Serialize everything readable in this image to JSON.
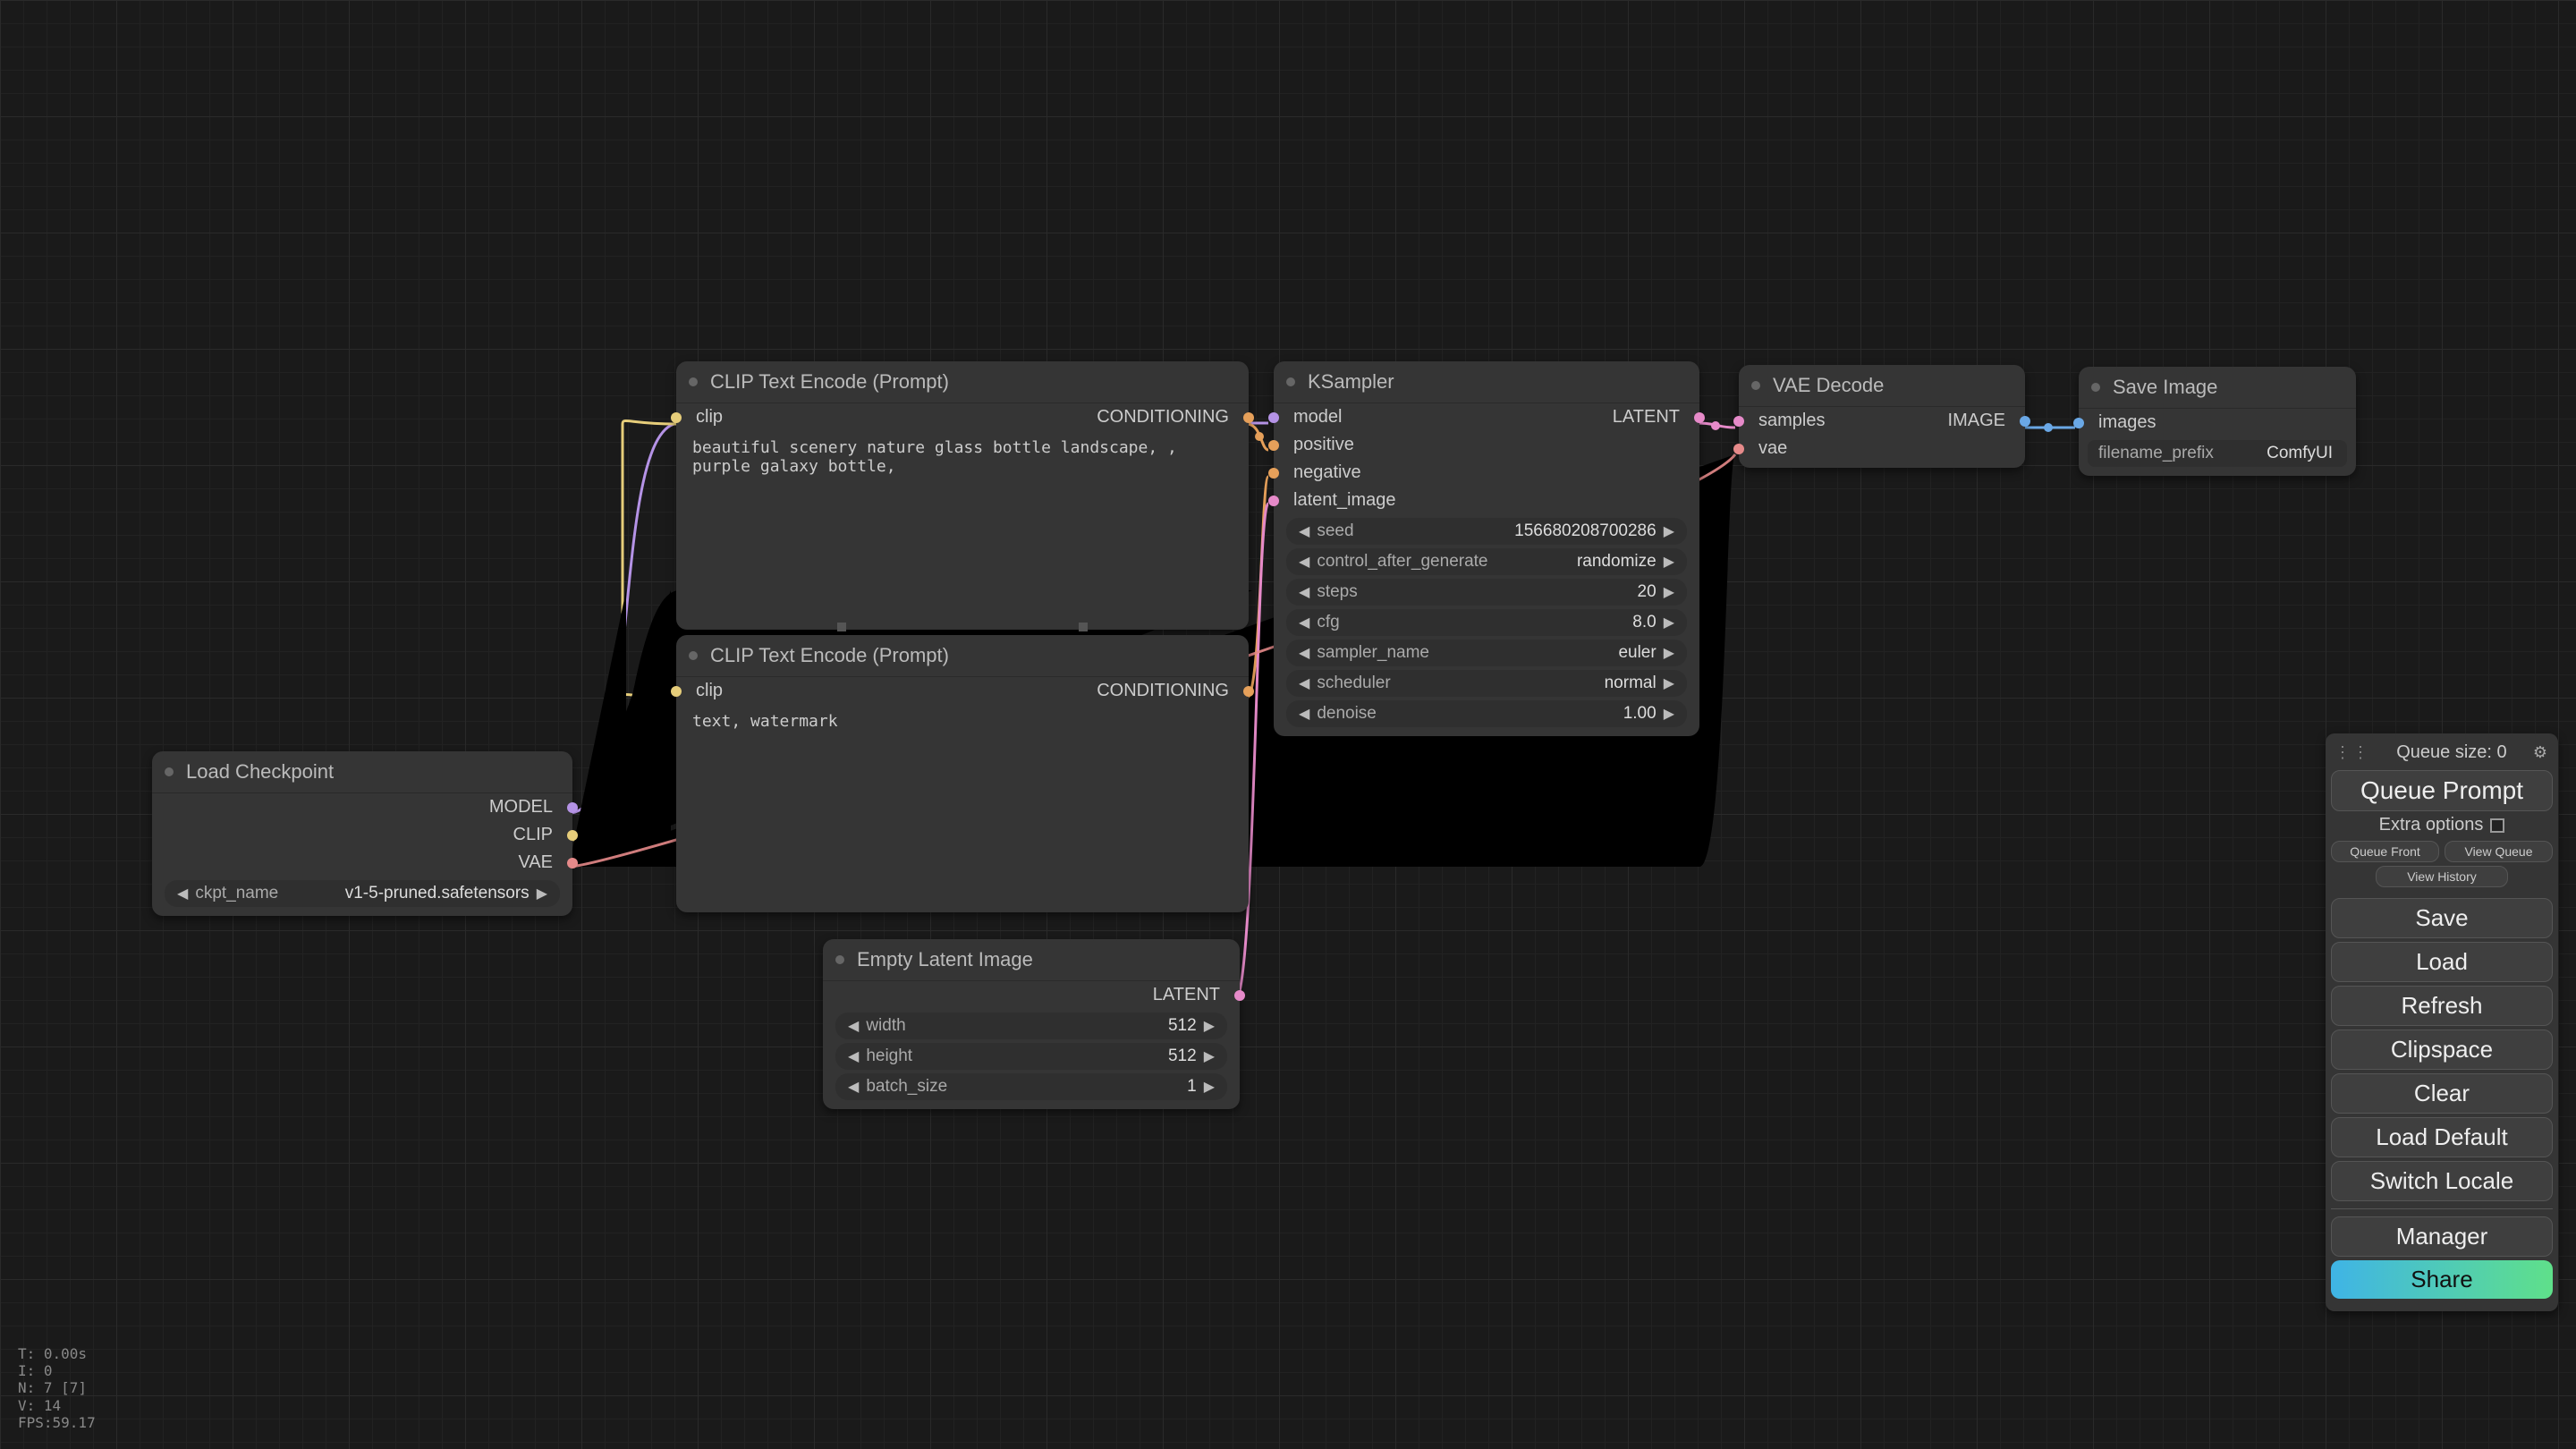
{
  "panel": {
    "queue_size_label": "Queue size: 0",
    "queue_prompt": "Queue Prompt",
    "extra_options": "Extra options",
    "queue_front": "Queue Front",
    "view_queue": "View Queue",
    "view_history": "View History",
    "save": "Save",
    "load": "Load",
    "refresh": "Refresh",
    "clipspace": "Clipspace",
    "clear": "Clear",
    "load_default": "Load Default",
    "switch_locale": "Switch Locale",
    "manager": "Manager",
    "share": "Share"
  },
  "stats": {
    "t": "T: 0.00s",
    "i": "I: 0",
    "n": "N: 7 [7]",
    "v": "V: 14",
    "fps": "FPS:59.17"
  },
  "nodes": {
    "load_checkpoint": {
      "title": "Load Checkpoint",
      "out_model": "MODEL",
      "out_clip": "CLIP",
      "out_vae": "VAE",
      "widget_name": "ckpt_name",
      "widget_value": "v1-5-pruned.safetensors"
    },
    "clip_pos": {
      "title": "CLIP Text Encode (Prompt)",
      "in_clip": "clip",
      "out_cond": "CONDITIONING",
      "text": "beautiful scenery nature glass bottle landscape, , purple galaxy bottle,"
    },
    "clip_neg": {
      "title": "CLIP Text Encode (Prompt)",
      "in_clip": "clip",
      "out_cond": "CONDITIONING",
      "text": "text, watermark"
    },
    "empty_latent": {
      "title": "Empty Latent Image",
      "out_latent": "LATENT",
      "w_width_name": "width",
      "w_width_val": "512",
      "w_height_name": "height",
      "w_height_val": "512",
      "w_batch_name": "batch_size",
      "w_batch_val": "1"
    },
    "ksampler": {
      "title": "KSampler",
      "in_model": "model",
      "in_positive": "positive",
      "in_negative": "negative",
      "in_latent": "latent_image",
      "out_latent": "LATENT",
      "w_seed_name": "seed",
      "w_seed_val": "156680208700286",
      "w_cag_name": "control_after_generate",
      "w_cag_val": "randomize",
      "w_steps_name": "steps",
      "w_steps_val": "20",
      "w_cfg_name": "cfg",
      "w_cfg_val": "8.0",
      "w_sampler_name": "sampler_name",
      "w_sampler_val": "euler",
      "w_sched_name": "scheduler",
      "w_sched_val": "normal",
      "w_denoise_name": "denoise",
      "w_denoise_val": "1.00"
    },
    "vae_decode": {
      "title": "VAE Decode",
      "in_samples": "samples",
      "in_vae": "vae",
      "out_image": "IMAGE"
    },
    "save_image": {
      "title": "Save Image",
      "in_images": "images",
      "w_prefix_name": "filename_prefix",
      "w_prefix_val": "ComfyUI"
    }
  }
}
